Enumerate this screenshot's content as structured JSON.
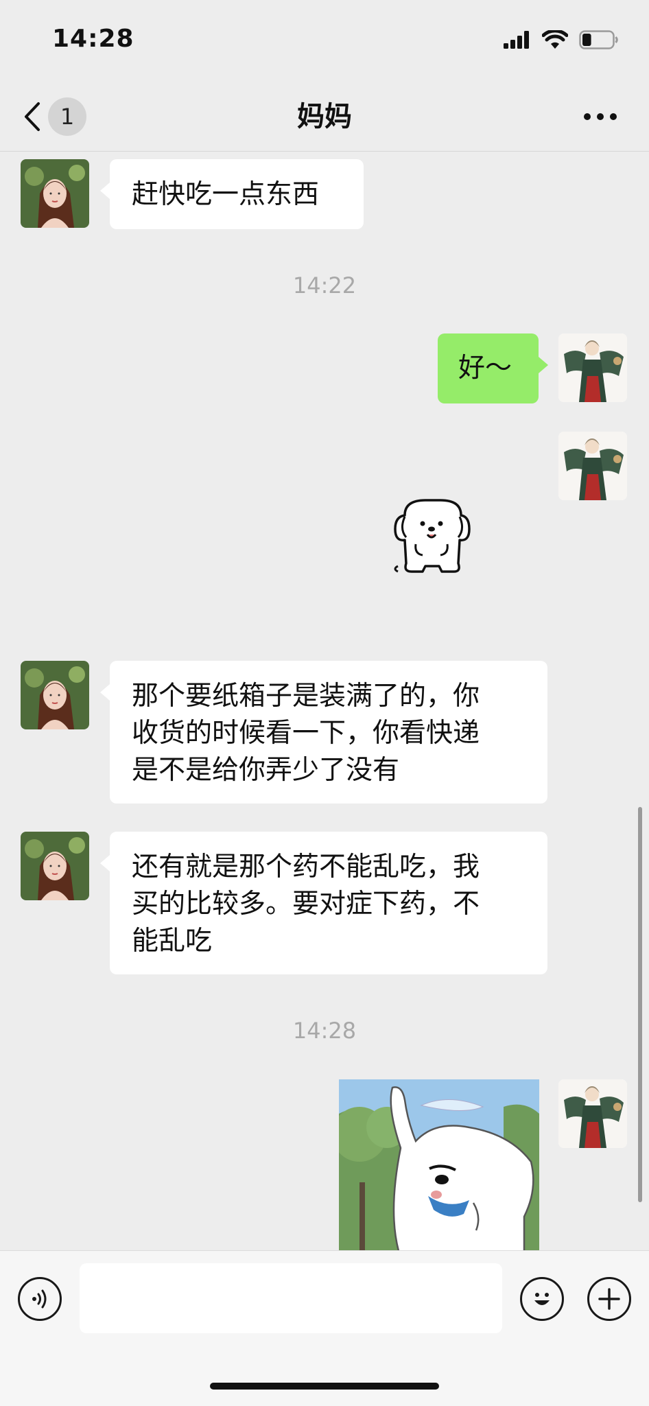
{
  "status_bar": {
    "time": "14:28",
    "signal_icon": "cellular-signal-icon",
    "wifi_icon": "wifi-icon",
    "battery_icon": "battery-icon",
    "battery_level": 0.3
  },
  "nav": {
    "back_icon": "chevron-left-icon",
    "unread_count": "1",
    "title": "妈妈",
    "more_icon": "more-dots-icon"
  },
  "messages": [
    {
      "sender": "mom",
      "type": "text",
      "text": "赶快吃一点东西"
    },
    {
      "type": "timestamp",
      "text": "14:22"
    },
    {
      "sender": "me",
      "type": "text",
      "text": "好～"
    },
    {
      "sender": "me",
      "type": "sticker",
      "icon": "puppy-sticker"
    },
    {
      "sender": "mom",
      "type": "text",
      "lines": [
        "那个要纸箱子是装满了的，你",
        "收货的时候看一下，你看快递",
        "是不是给你弄少了没有"
      ]
    },
    {
      "sender": "mom",
      "type": "text",
      "lines": [
        "还有就是那个药不能乱吃，我",
        "买的比较多。要对症下药，不",
        "能乱吃"
      ]
    },
    {
      "type": "timestamp",
      "text": "14:28"
    },
    {
      "sender": "me",
      "type": "image",
      "icon": "cartoon-dog-image"
    }
  ],
  "input_bar": {
    "voice_icon": "voice-icon",
    "placeholder": "",
    "emoji_icon": "emoji-icon",
    "plus_icon": "plus-icon"
  },
  "colors": {
    "background": "#ededed",
    "sent_bubble": "#95ec69",
    "received_bubble": "#ffffff",
    "timestamp": "#a8a8a8"
  }
}
